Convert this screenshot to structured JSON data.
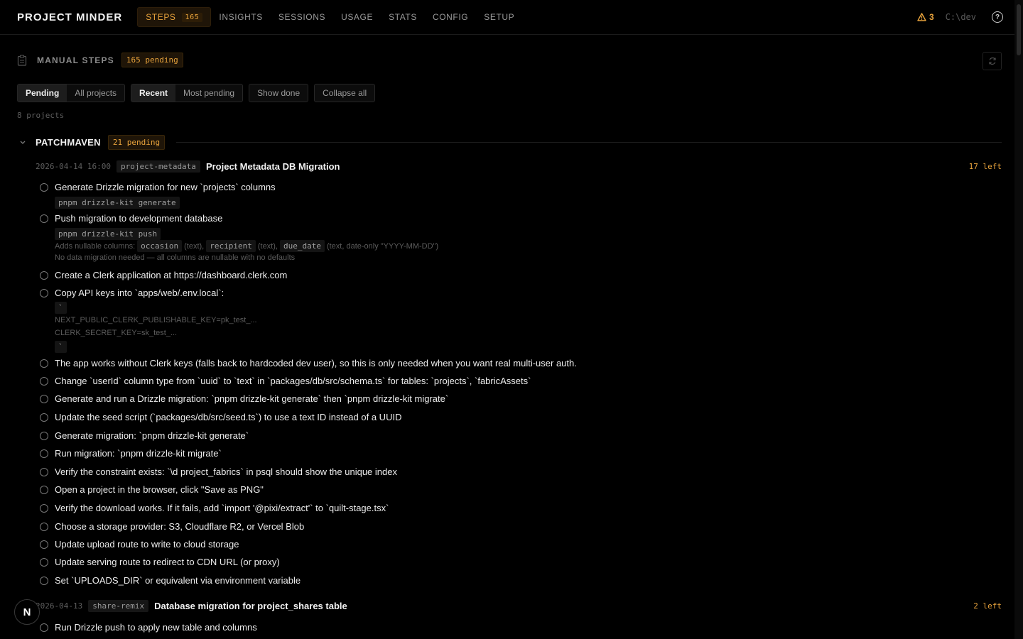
{
  "app": {
    "title": "PROJECT MINDER",
    "cwd": "C:\\dev",
    "warnings": "3"
  },
  "nav": [
    {
      "label": "STEPS",
      "badge": "165",
      "active": true
    },
    {
      "label": "INSIGHTS"
    },
    {
      "label": "SESSIONS"
    },
    {
      "label": "USAGE"
    },
    {
      "label": "STATS"
    },
    {
      "label": "CONFIG"
    },
    {
      "label": "SETUP"
    }
  ],
  "header": {
    "title": "MANUAL STEPS",
    "pending": "165 pending"
  },
  "filters": {
    "scope": [
      "Pending",
      "All projects"
    ],
    "sort": [
      "Recent",
      "Most pending"
    ],
    "show_done": "Show done",
    "collapse": "Collapse all"
  },
  "project_count": "8 projects",
  "project": {
    "name": "PATCHMAVEN",
    "pending": "21 pending"
  },
  "runs": [
    {
      "timestamp": "2026-04-14 16:00",
      "tag": "project-metadata",
      "title": "Project Metadata DB Migration",
      "left": "17 left",
      "steps": [
        {
          "text": "Generate Drizzle migration for new `projects` columns",
          "code": "pnpm drizzle-kit generate"
        },
        {
          "text": "Push migration to development database",
          "code": "pnpm drizzle-kit push",
          "note_prefix": "Adds nullable columns:",
          "cols": [
            "occasion",
            "recipient",
            "due_date"
          ],
          "col_types": [
            "(text),",
            "(text),",
            "(text, date-only \"YYYY-MM-DD\")"
          ],
          "note2": "No data migration needed — all columns are nullable with no defaults"
        },
        {
          "text": "Create a Clerk application at https://dashboard.clerk.com"
        },
        {
          "text": "Copy API keys into `apps/web/.env.local`:",
          "fence": "`",
          "env1": "NEXT_PUBLIC_CLERK_PUBLISHABLE_KEY=pk_test_...",
          "env2": "CLERK_SECRET_KEY=sk_test_..."
        },
        {
          "text": "The app works without Clerk keys (falls back to hardcoded dev user), so this is only needed when you want real multi-user auth."
        },
        {
          "text": "Change `userId` column type from `uuid` to `text` in `packages/db/src/schema.ts` for tables: `projects`, `fabricAssets`"
        },
        {
          "text": "Generate and run a Drizzle migration: `pnpm drizzle-kit generate` then `pnpm drizzle-kit migrate`"
        },
        {
          "text": "Update the seed script (`packages/db/src/seed.ts`) to use a text ID instead of a UUID"
        },
        {
          "text": "Generate migration: `pnpm drizzle-kit generate`"
        },
        {
          "text": "Run migration: `pnpm drizzle-kit migrate`"
        },
        {
          "text": "Verify the constraint exists: `\\d project_fabrics` in psql should show the unique index"
        },
        {
          "text": "Open a project in the browser, click \"Save as PNG\""
        },
        {
          "text": "Verify the download works. If it fails, add `import '@pixi/extract'` to `quilt-stage.tsx`"
        },
        {
          "text": "Choose a storage provider: S3, Cloudflare R2, or Vercel Blob"
        },
        {
          "text": "Update upload route to write to cloud storage"
        },
        {
          "text": "Update serving route to redirect to CDN URL (or proxy)"
        },
        {
          "text": "Set `UPLOADS_DIR` or equivalent via environment variable"
        }
      ]
    },
    {
      "timestamp": "2026-04-13",
      "tag": "share-remix",
      "title": "Database migration for project_shares table",
      "left": "2 left",
      "steps": [
        {
          "text": "Run Drizzle push to apply new table and columns"
        }
      ]
    }
  ],
  "fab": "N",
  "colors": {
    "accent": "#e8a33c",
    "background": "#000000",
    "text": "#ededed"
  }
}
